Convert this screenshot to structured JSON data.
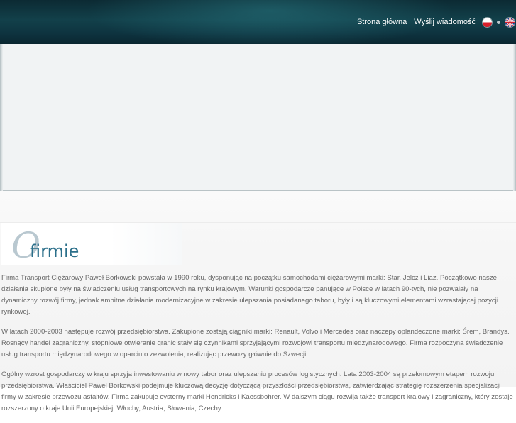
{
  "header": {
    "nav": [
      {
        "label": "Strona główna"
      },
      {
        "label": "Wyślij wiadomość"
      }
    ],
    "languages": [
      {
        "code": "pl",
        "icon": "flag-poland-icon"
      },
      {
        "code": "en",
        "icon": "flag-uk-icon"
      }
    ],
    "colors": {
      "header_bg": "#0e3440",
      "nav_text": "#ffffff"
    }
  },
  "section": {
    "title_letter": "O",
    "title_rest": "firmie",
    "title_color": "#2b6f8a"
  },
  "content": {
    "paragraphs": [
      "Firma Transport Ciężarowy Paweł Borkowski powstała w 1990 roku, dysponując na początku samochodami ciężarowymi marki: Star, Jelcz i Liaz. Początkowo nasze działania skupione były na świadczeniu usług transportowych na rynku krajowym. Warunki gospodarcze panujące w Polsce w latach 90-tych, nie pozwalały na dynamiczny rozwój firmy, jednak ambitne działania modernizacyjne w zakresie ulepszania posiadanego taboru, były i są kluczowymi elementami wzrastającej pozycji rynkowej.",
      "W latach 2000-2003 następuje rozwój przedsiębiorstwa. Zakupione zostają ciągniki marki: Renault, Volvo i Mercedes oraz naczepy oplandeczone marki: Śrem, Brandys. Rosnący handel zagraniczny, stopniowe otwieranie granic stały się czynnikami sprzyjającymi rozwojowi transportu międzynarodowego. Firma rozpoczyna świadczenie usług transportu międzynarodowego w oparciu o zezwolenia, realizując przewozy głównie do Szwecji.",
      "Ogólny wzrost gospodarczy w kraju sprzyja inwestowaniu w nowy tabor oraz ulepszaniu procesów logistycznych. Lata 2003-2004 są przełomowym etapem rozwoju przedsiębiorstwa. Właściciel Paweł Borkowski podejmuje kluczową decyzję dotyczącą przyszłości przedsiębiorstwa, zatwierdzając strategię rozszerzenia specjalizacji firmy w zakresie przewozu asfaltów. Firma zakupuje cysterny marki Hendricks i Kaessbohrer. W dalszym ciągu rozwija także transport krajowy i zagraniczny, który zostaje rozszerzony o kraje Unii Europejskiej: Włochy, Austria, Słowenia, Czechy."
    ]
  }
}
